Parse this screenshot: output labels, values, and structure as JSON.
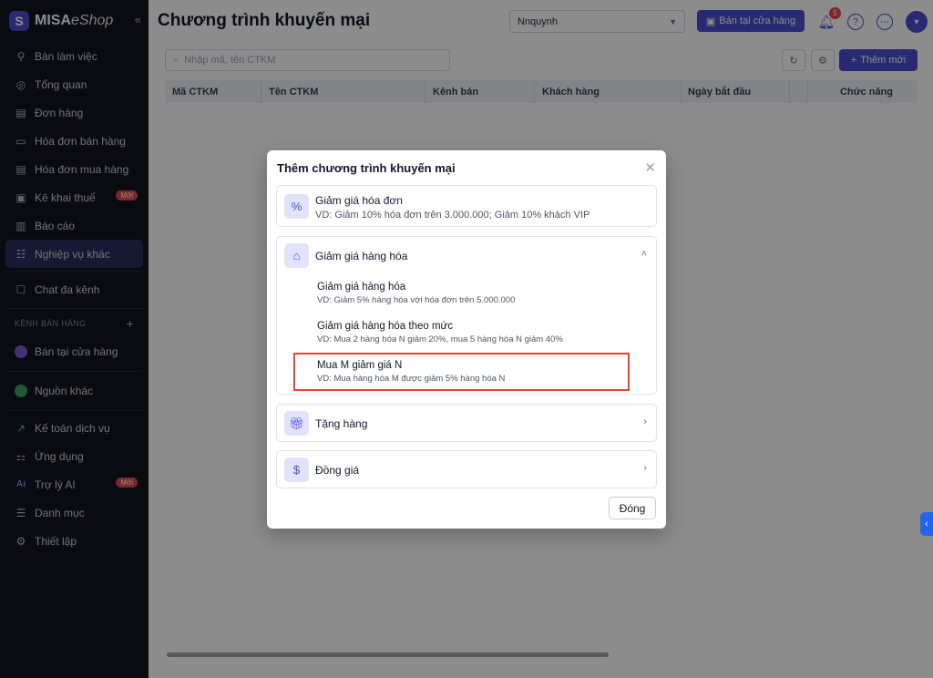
{
  "brand": {
    "name": "MISA",
    "product": "eShop",
    "collapse_icon": "«"
  },
  "sidebar": {
    "items": [
      {
        "label": "Bàn làm việc",
        "icon": "desk-icon"
      },
      {
        "label": "Tổng quan",
        "icon": "compass-icon"
      },
      {
        "label": "Đơn hàng",
        "icon": "order-icon"
      },
      {
        "label": "Hóa đơn bán hàng",
        "icon": "invoice-icon"
      },
      {
        "label": "Hóa đơn mua hàng",
        "icon": "purchase-invoice-icon"
      },
      {
        "label": "Kê khai thuế",
        "icon": "tax-icon",
        "badge": "Mới"
      },
      {
        "label": "Báo cáo",
        "icon": "report-icon"
      },
      {
        "label": "Nghiệp vụ khác",
        "icon": "operations-icon",
        "active": true
      }
    ],
    "chat": {
      "label": "Chat đa kênh"
    },
    "channels_header": "KÊNH BÁN HÀNG",
    "channels": [
      {
        "label": "Bán tại cửa hàng"
      },
      {
        "label": "Nguồn khác"
      }
    ],
    "bottom": [
      {
        "label": "Kế toán dịch vụ"
      },
      {
        "label": "Ứng dụng"
      },
      {
        "label": "Trợ lý AI",
        "badge": "Mới"
      },
      {
        "label": "Danh mục"
      },
      {
        "label": "Thiết lập"
      }
    ]
  },
  "header": {
    "title": "Chương trình khuyến mại",
    "branch": "Nnquynh",
    "store_button": "Bán tại cửa hàng",
    "notification_count": "5"
  },
  "toolbar": {
    "search_placeholder": "Nhập mã, tên CTKM",
    "add_button": "Thêm mới"
  },
  "table": {
    "columns": [
      "Mã CTKM",
      "Tên CTKM",
      "Kênh bán",
      "Khách hàng",
      "Ngày bắt đầu",
      "",
      "Chức năng"
    ]
  },
  "modal": {
    "title": "Thêm chương trình khuyến mại",
    "invoice_discount": {
      "title": "Giảm giá hóa đơn",
      "desc": "VD: Giảm 10% hóa đơn trên 3.000.000; Giảm 10% khách VIP"
    },
    "goods_discount": {
      "title": "Giảm giá hàng hóa",
      "options": [
        {
          "title": "Giảm giá hàng hóa",
          "desc": "VD: Giảm 5% hàng hóa với hóa đơn trên 5.000.000"
        },
        {
          "title": "Giảm giá hàng hóa theo mức",
          "desc": "VD: Mua 2 hàng hóa N giảm 20%, mua 5 hàng hóa N giảm 40%"
        },
        {
          "title": "Mua M giảm giá N",
          "desc": "VD: Mua hàng hóa M được giảm 5% hàng hóa N"
        }
      ]
    },
    "gift": {
      "title": "Tặng hàng"
    },
    "same_price": {
      "title": "Đồng giá"
    },
    "close_button": "Đóng"
  },
  "colors": {
    "accent": "#4b4fd0",
    "highlight": "#e0453a",
    "badge": "#e24a4a"
  }
}
